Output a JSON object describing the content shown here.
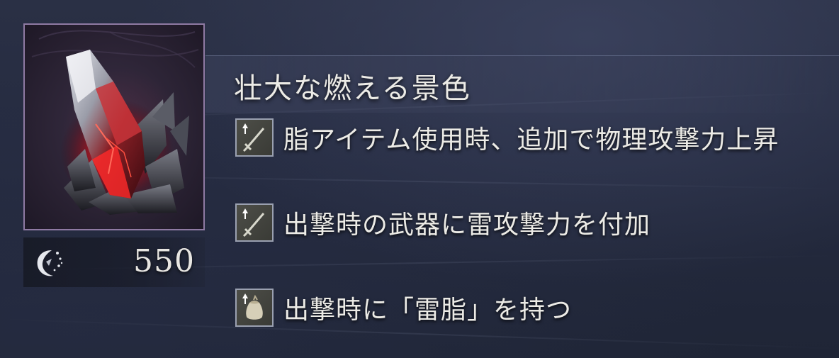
{
  "item": {
    "name": "壮大な燃える景色",
    "icon": "red-crystal-relic-icon",
    "frame_color": "#8f7aa3"
  },
  "price": {
    "icon": "rune-currency-icon",
    "value": "550"
  },
  "effects": [
    {
      "icon": "sword-up-arrow-icon",
      "text": "脂アイテム使用時、追加で物理攻撃力上昇"
    },
    {
      "icon": "sword-up-arrow-icon",
      "text": "出撃時の武器に雷攻撃力を付加"
    },
    {
      "icon": "pouch-up-arrow-icon",
      "text": "出撃時に「雷脂」を持つ"
    }
  ]
}
